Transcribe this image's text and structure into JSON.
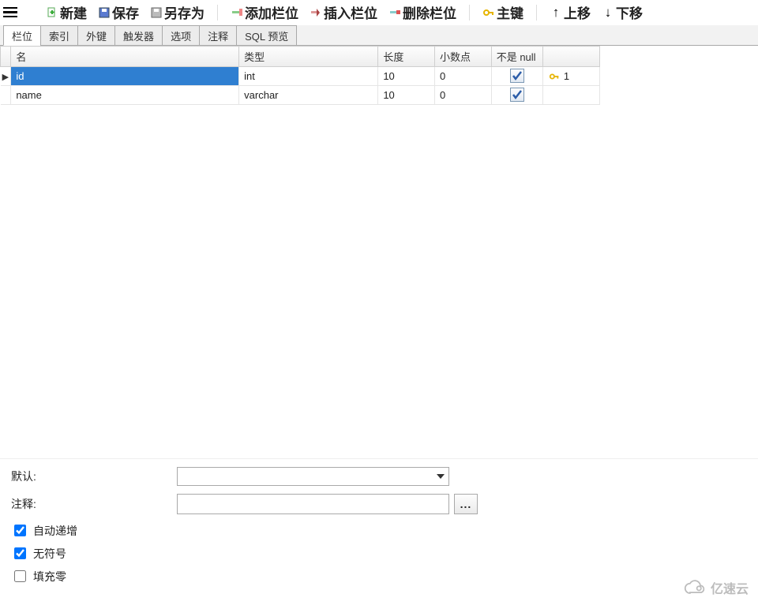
{
  "toolbar": {
    "new": "新建",
    "save": "保存",
    "save_as": "另存为",
    "add_field": "添加栏位",
    "insert_field": "插入栏位",
    "delete_field": "删除栏位",
    "primary_key": "主键",
    "move_up": "上移",
    "move_down": "下移"
  },
  "tabs": {
    "fields": "栏位",
    "indexes": "索引",
    "fks": "外键",
    "triggers": "触发器",
    "options": "选项",
    "comment": "注释",
    "sql_preview": "SQL 预览"
  },
  "grid": {
    "headers": {
      "name": "名",
      "type": "类型",
      "length": "长度",
      "decimals": "小数点",
      "not_null": "不是 null",
      "key": ""
    },
    "rows": [
      {
        "name": "id",
        "type": "int",
        "length": "10",
        "decimals": "0",
        "not_null": true,
        "key_index": "1",
        "selected": true
      },
      {
        "name": "name",
        "type": "varchar",
        "length": "10",
        "decimals": "0",
        "not_null": true,
        "key_index": "",
        "selected": false
      }
    ]
  },
  "props": {
    "default_label": "默认:",
    "comment_label": "注释:",
    "default_value": "",
    "comment_value": "",
    "auto_increment": {
      "label": "自动递增",
      "checked": true
    },
    "unsigned": {
      "label": "无符号",
      "checked": true
    },
    "zerofill": {
      "label": "填充零",
      "checked": false
    }
  },
  "watermark": "亿速云"
}
